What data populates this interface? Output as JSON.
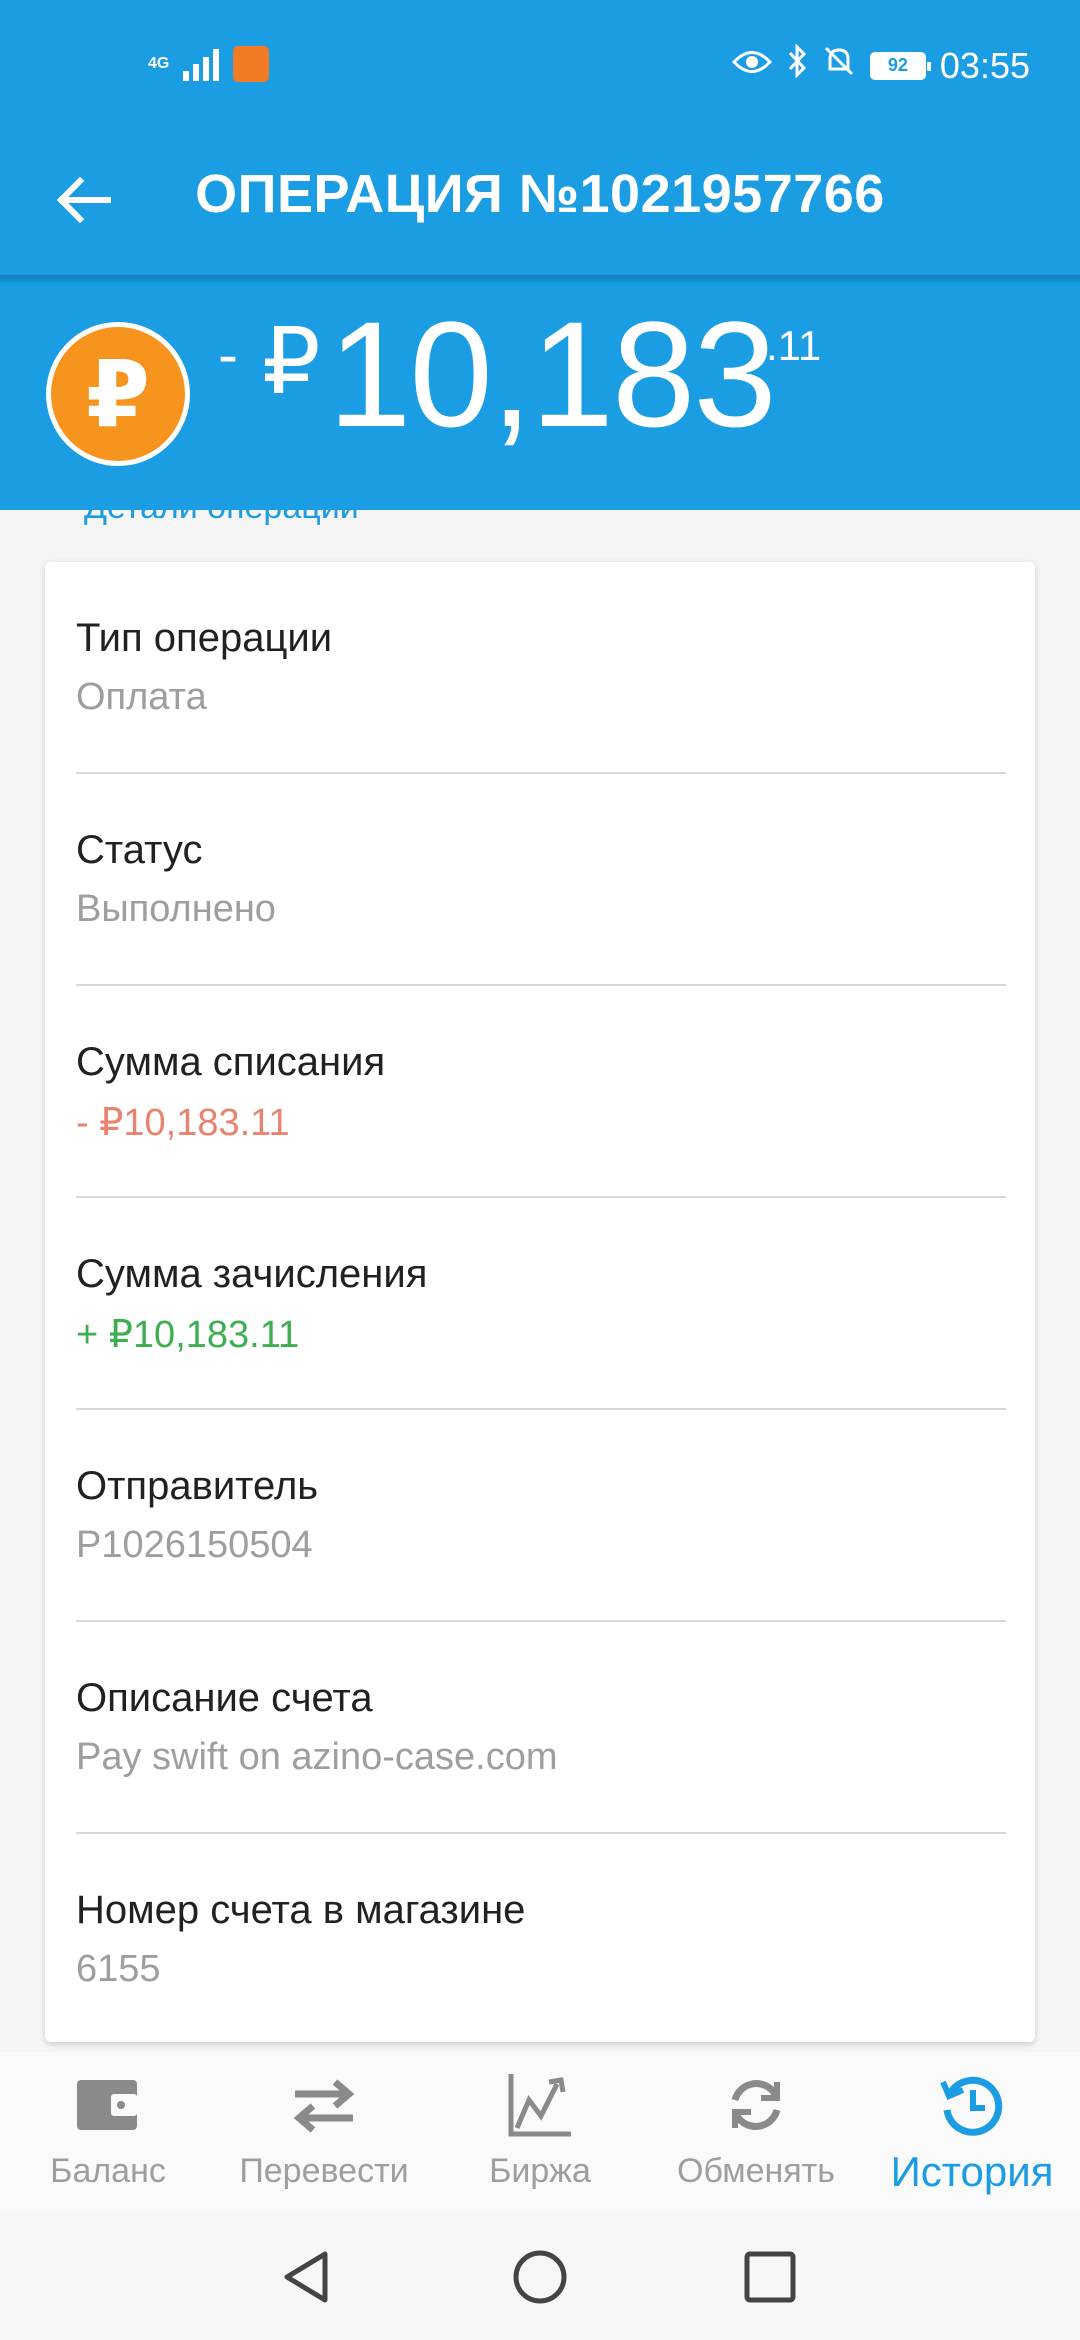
{
  "status_bar": {
    "network": "4G",
    "battery": "92",
    "time": "03:55"
  },
  "toolbar": {
    "title": "ОПЕРАЦИЯ №1021957766"
  },
  "amount": {
    "sign": "-",
    "currency": "₽",
    "integer": "10,183",
    "decimal": ".11",
    "coin_symbol": "₽"
  },
  "details_label": "Детали операции",
  "details": [
    {
      "label": "Тип операции",
      "value": "Оплата",
      "color": "gray"
    },
    {
      "label": "Статус",
      "value": "Выполнено",
      "color": "gray"
    },
    {
      "label": "Сумма списания",
      "value": " - ₽10,183.11",
      "color": "red"
    },
    {
      "label": "Сумма зачисления",
      "value": " + ₽10,183.11",
      "color": "green"
    },
    {
      "label": "Отправитель",
      "value": "P1026150504",
      "color": "gray"
    },
    {
      "label": "Описание счета",
      "value": "Pay swift on azino-case.com",
      "color": "gray"
    },
    {
      "label": "Номер счета в магазине",
      "value": "6155",
      "color": "gray"
    }
  ],
  "bottom_nav": [
    {
      "label": "Баланс",
      "icon": "wallet-icon",
      "active": false
    },
    {
      "label": "Перевести",
      "icon": "transfer-icon",
      "active": false
    },
    {
      "label": "Биржа",
      "icon": "chart-icon",
      "active": false
    },
    {
      "label": "Обменять",
      "icon": "exchange-icon",
      "active": false
    },
    {
      "label": "История",
      "icon": "history-icon",
      "active": true
    }
  ],
  "colors": {
    "primary": "#1a9de3",
    "coin": "#f7941d",
    "debit": "#e8836f",
    "credit": "#3fae52"
  }
}
